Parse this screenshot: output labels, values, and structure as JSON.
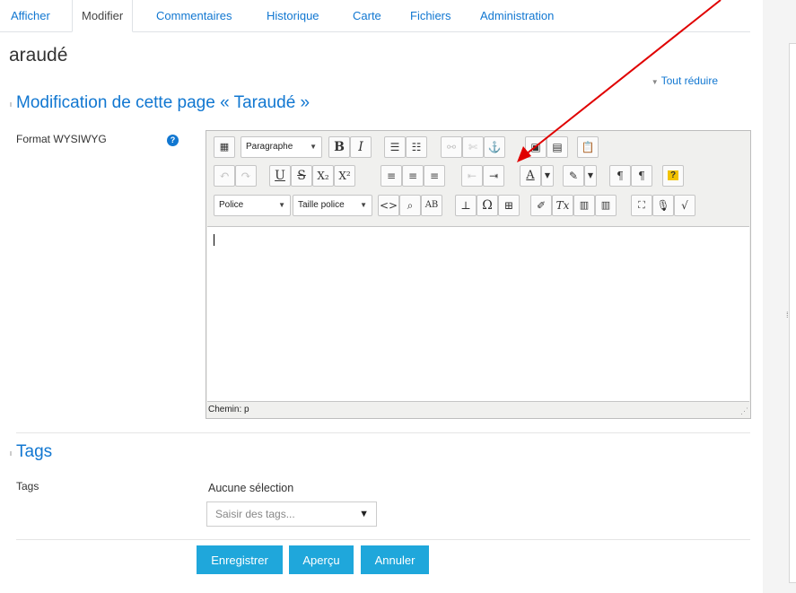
{
  "tabs": [
    {
      "label": "Afficher"
    },
    {
      "label": "Modifier"
    },
    {
      "label": "Commentaires"
    },
    {
      "label": "Historique"
    },
    {
      "label": "Carte"
    },
    {
      "label": "Fichiers"
    },
    {
      "label": "Administration"
    }
  ],
  "page_title": "araudé",
  "collapse_all": "Tout réduire",
  "form_section_title": "Modification de cette page « Taraudé »",
  "format_label": "Format WYSIWYG",
  "editor": {
    "paragraph_select": "Paragraphe",
    "font_select": "Police",
    "size_select": "Taille police",
    "path_label": "Chemin: p"
  },
  "tags_section_title": "Tags",
  "tags_label": "Tags",
  "tags_none_selected": "Aucune sélection",
  "tags_placeholder": "Saisir des tags...",
  "buttons": {
    "save": "Enregistrer",
    "preview": "Aperçu",
    "cancel": "Annuler"
  },
  "colors": {
    "accent": "#1177d1",
    "button": "#1fa7db",
    "annotation_arrow": "#e00000"
  }
}
